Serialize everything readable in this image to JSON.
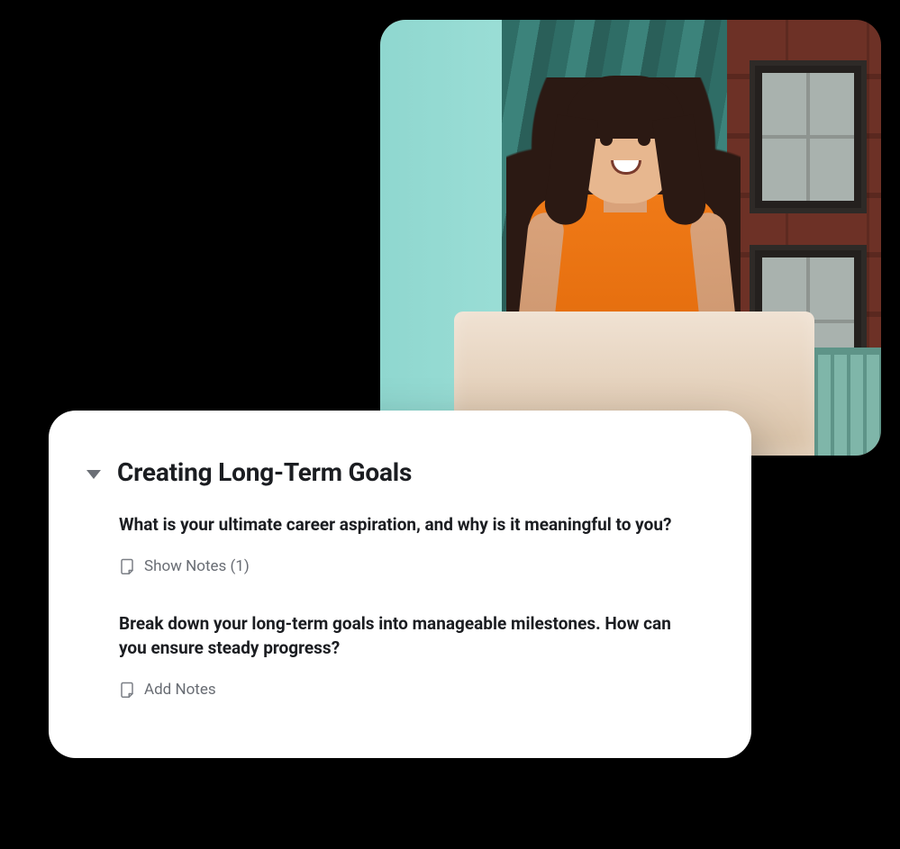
{
  "hero": {
    "alt": "Woman with long dark wavy hair wearing an orange sleeveless top, smiling while working on a laptop near a window with a teal wall, teal curtain and brick building visible outside"
  },
  "card": {
    "title": "Creating Long-Term Goals",
    "prompts": [
      {
        "question": "What is your ultimate career aspiration, and why is it meaningful to you?",
        "action_label": "Show Notes (1)"
      },
      {
        "question": "Break down your long-term goals into manageable milestones. How can you ensure steady progress?",
        "action_label": "Add Notes"
      }
    ]
  }
}
